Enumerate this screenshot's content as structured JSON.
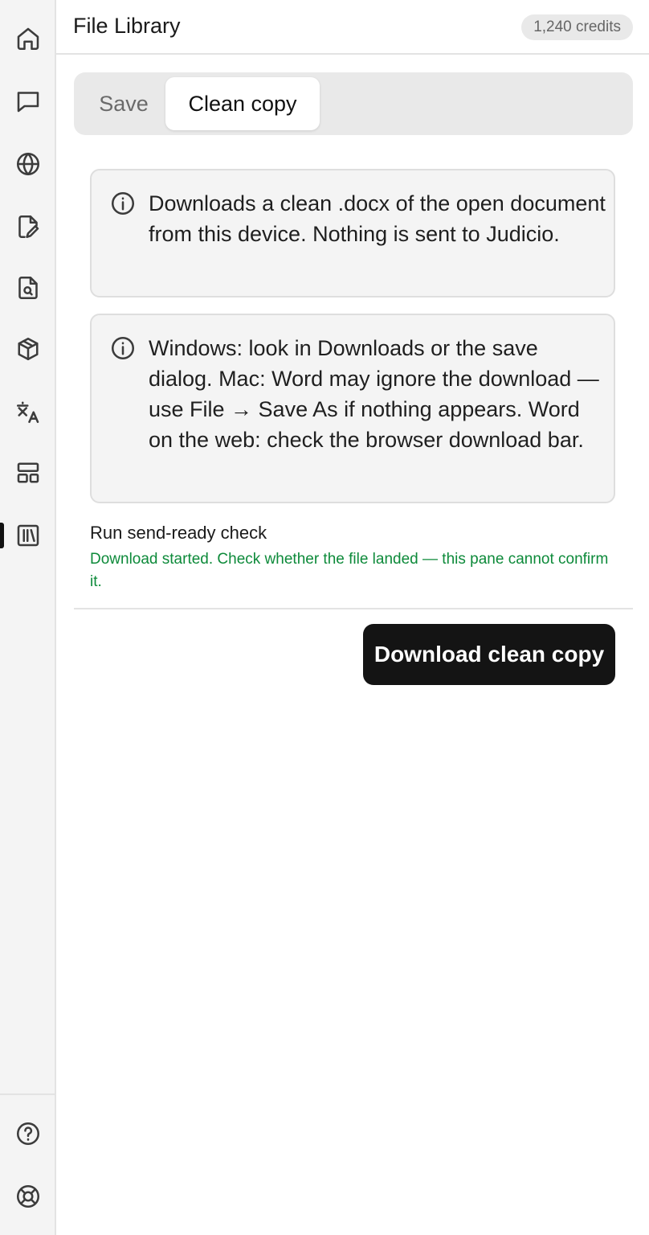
{
  "header": {
    "title": "File Library",
    "credits": "1,240 credits"
  },
  "sidebar": {
    "items": [
      {
        "icon": "home-icon"
      },
      {
        "icon": "chat-icon"
      },
      {
        "icon": "globe-icon"
      },
      {
        "icon": "document-edit-icon"
      },
      {
        "icon": "document-search-icon"
      },
      {
        "icon": "package-icon"
      },
      {
        "icon": "translate-icon"
      },
      {
        "icon": "layout-icon"
      },
      {
        "icon": "library-icon",
        "active": true
      }
    ],
    "bottom_items": [
      {
        "icon": "help-icon"
      },
      {
        "icon": "support-icon"
      }
    ]
  },
  "tabs": [
    {
      "label": "Save",
      "selected": false
    },
    {
      "label": "Clean copy",
      "selected": true
    }
  ],
  "info_boxes": [
    {
      "text": "Downloads a clean .docx of the open document from this device. Nothing is sent to Judicio."
    },
    {
      "text": "Windows: look in Downloads or the save dialog. Mac: Word may ignore the download — use File → Save As if nothing appears. Word on the web: check the browser download bar."
    }
  ],
  "status": {
    "check_label": "Run send-ready check",
    "message": "Download started. Check whether the file landed — this pane cannot confirm it.",
    "message_color": "#0d8a3a"
  },
  "actions": {
    "download_label": "Download clean copy"
  }
}
